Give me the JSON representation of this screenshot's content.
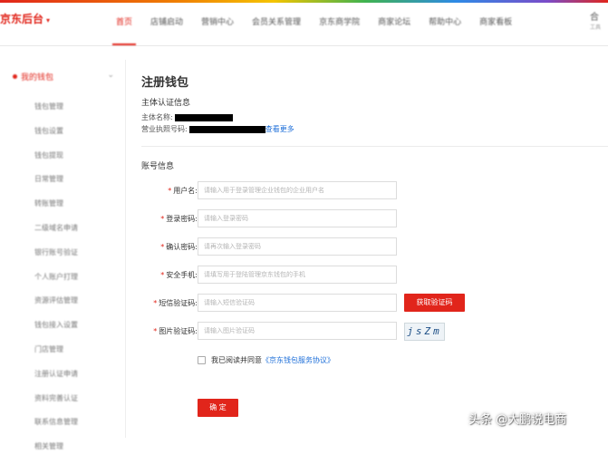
{
  "brand": {
    "name": "京东后台",
    "caret": "▾"
  },
  "nav": [
    {
      "label": "首页",
      "active": true
    },
    {
      "label": "店铺启动"
    },
    {
      "label": "营销中心"
    },
    {
      "label": "会员关系管理"
    },
    {
      "label": "京东商学院"
    },
    {
      "label": "商家论坛"
    },
    {
      "label": "帮助中心"
    },
    {
      "label": "商家看板"
    }
  ],
  "user": {
    "name": "合",
    "sub": "工具"
  },
  "sidebar": {
    "header": "我的钱包",
    "caret": "⌄",
    "items": [
      "钱包管理",
      "钱包设置",
      "钱包提现",
      "日常管理",
      "转账管理",
      "二级域名申请",
      "银行账号验证",
      "个人账户打理",
      "资源评估管理",
      "钱包接入设置",
      "门店管理",
      "注册认证申请",
      "资料完善认证",
      "联系信息管理",
      "相关管理"
    ]
  },
  "main": {
    "title": "注册钱包",
    "entity": {
      "section": "主体认证信息",
      "name_label": "主体名称:",
      "license_label": "营业执照号码:",
      "view_more": "查看更多"
    },
    "account": {
      "section": "账号信息",
      "username_label": "用户名:",
      "username_placeholder": "请输入用于登录管理企业钱包的企业用户名",
      "password_label": "登录密码:",
      "password_placeholder": "请输入登录密码",
      "confirm_label": "确认密码:",
      "confirm_placeholder": "请再次输入登录密码",
      "phone_label": "安全手机:",
      "phone_placeholder": "请填写用于登陆管理京东钱包的手机",
      "sms_label": "短信验证码:",
      "sms_placeholder": "请输入短信验证码",
      "get_code": "获取验证码",
      "img_label": "图片验证码:",
      "img_placeholder": "请输入图片验证码",
      "captcha_text": "jsZm"
    },
    "agree_prefix": "我已阅读并同意",
    "agree_link": "《京东钱包服务协议》",
    "confirm_button": "确 定"
  },
  "watermark": "头条 @大鹏说电商",
  "colors": {
    "accent": "#e1251b",
    "link": "#1e6fd9"
  }
}
